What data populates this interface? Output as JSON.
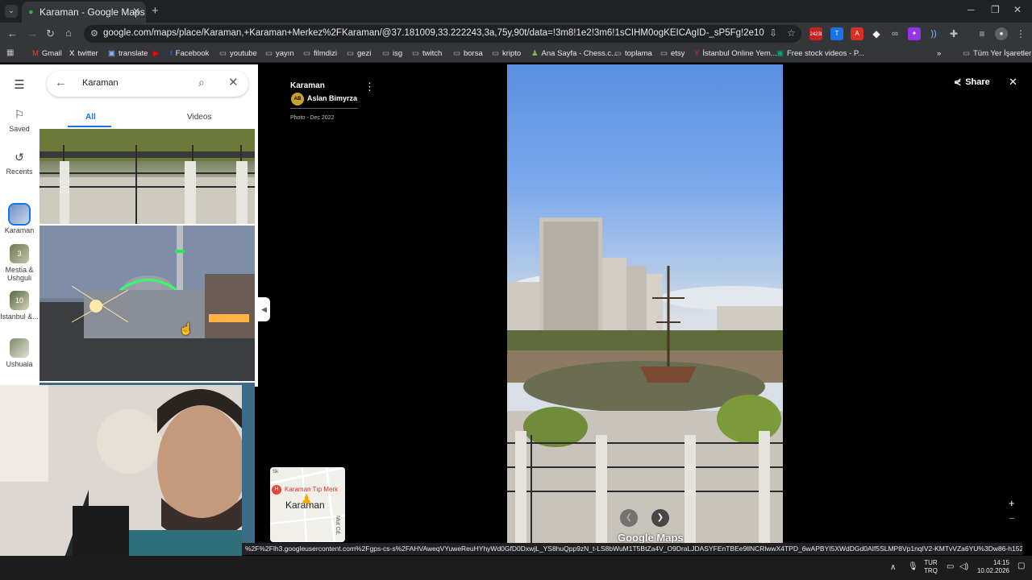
{
  "browser": {
    "tab": {
      "title": "Karaman - Google Maps",
      "close": "✕"
    },
    "new_tab": "+",
    "window_controls": {
      "minimize": "─",
      "restore": "❐",
      "close": "✕"
    },
    "url": "google.com/maps/place/Karaman,+Karaman+Merkez%2FKaraman/@37.181009,33.222243,3a,75y,90t/data=!3m8!1e2!3m6!1sCIHM0ogKEICAgID-_sP5Fg!2e10!3e12!6shttps:%2F%2Flh3.googleuserc...",
    "bookmarks": [
      "Gmail",
      "twitter",
      "translate",
      "Facebook",
      "youtube",
      "yayın",
      "filmdizi",
      "gezi",
      "isg",
      "twitch",
      "borsa",
      "kripto",
      "Ana Sayfa - Chess.c...",
      "toplama",
      "etsy",
      "İstanbul Online Yem...",
      "Free stock videos - P..."
    ],
    "bookmarks_more": "»",
    "all_bookmarks": "Tüm Yer İşaretleri",
    "extension_badge": "2423t",
    "status_url": "%2F%2Flh3.googleusercontent.com%2Fgps-cs-s%2FAHVAweqVYuweReuHYhyWd0GfD0DxwjL_YS8huQpp9zN_t-LS8bWuM1T5BtZa4V_O9DraLJDASYFEnTBEe9llNCRlwwX4TPD_6wAPBYI5XWdDGd0AIf5SLMP8Vp1nqIV2-KMTvVZa6YU%3Dw86-h152-k-no!7i1080!8i1920!4m..."
  },
  "maps": {
    "rail": {
      "menu": "☰",
      "saved": "Saved",
      "recents": "Recents",
      "places": [
        {
          "label": "Karaman",
          "badge": ""
        },
        {
          "label": "Mestia & Ushguli",
          "badge": "3"
        },
        {
          "label": "Istanbul &...",
          "badge": "10"
        },
        {
          "label": "Ushuaia",
          "badge": ""
        }
      ]
    },
    "search": {
      "query": "Karaman"
    },
    "tabs": {
      "all": "All",
      "videos": "Videos"
    },
    "lightbox": {
      "place": "Karaman",
      "author_initials": "AB",
      "author": "Aslan Bimyrza",
      "date": "Photo - Dec 2022",
      "share": "Share",
      "logo": "Google Maps",
      "minimap": {
        "poi": "Karaman Tıp Merk",
        "city": "Karaman",
        "road": "Mut Cd.",
        "corner": "Sk"
      },
      "zoom_in": "+",
      "zoom_out": "−"
    }
  },
  "taskbar": {
    "lang1": "TUR",
    "lang2": "TRQ",
    "time": "14:15",
    "date": "10.02.2026"
  },
  "colors": {
    "accent": "#1a73e8",
    "chrome_dark": "#202124",
    "chrome_mid": "#35363a"
  }
}
